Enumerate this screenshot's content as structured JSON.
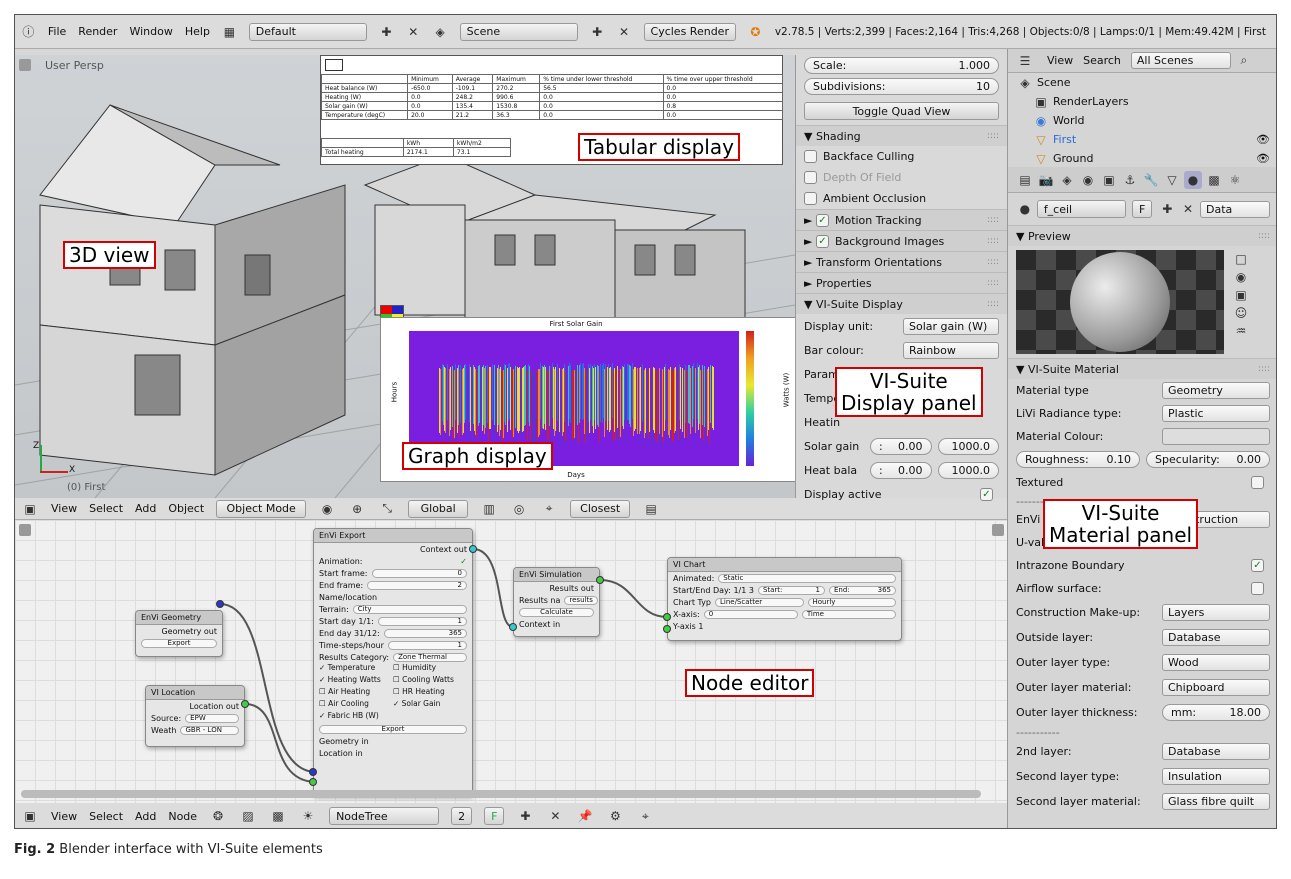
{
  "top_bar": {
    "menus": [
      "File",
      "Render",
      "Window",
      "Help"
    ],
    "layout": "Default",
    "scene": "Scene",
    "engine": "Cycles Render",
    "stats": "v2.78.5 | Verts:2,399 | Faces:2,164 | Tris:4,268 | Objects:0/8 | Lamps:0/1 | Mem:49.42M | First"
  },
  "view3d": {
    "label": "User Persp",
    "obj_label": "(0) First",
    "axis_x": "X",
    "axis_y": "Y",
    "axis_z": "Z"
  },
  "view3d_header": {
    "menus": [
      "View",
      "Select",
      "Add",
      "Object"
    ],
    "mode": "Object Mode",
    "orientation": "Global",
    "snap": "Closest"
  },
  "table": {
    "headers": [
      "",
      "Minimum",
      "Average",
      "Maximum",
      "% time under lower threshold",
      "% time over upper threshold"
    ],
    "rows": [
      [
        "Heat balance (W)",
        "-650.0",
        "-109.1",
        "270.2",
        "56.5",
        "0.0"
      ],
      [
        "Heating (W)",
        "0.0",
        "248.2",
        "990.6",
        "0.0",
        "0.0"
      ],
      [
        "Solar gain (W)",
        "0.0",
        "135.4",
        "1530.8",
        "0.0",
        "0.8"
      ],
      [
        "Temperature (degC)",
        "20.0",
        "21.2",
        "36.3",
        "0.0",
        "0.0"
      ]
    ],
    "headers2": [
      "",
      "kWh",
      "kWh/m2"
    ],
    "rows2": [
      [
        "Total heating",
        "2174.1",
        "73.1"
      ]
    ]
  },
  "graph": {
    "title": "First Solar Gain",
    "xlabel": "Days",
    "ylabel": "Hours",
    "colorbar_label": "Watts (W)",
    "xticks": [
      "0",
      "50",
      "100",
      "150",
      "200",
      "250",
      "300",
      "350"
    ],
    "yticks": [
      "0",
      "5",
      "10",
      "15",
      "20"
    ],
    "cticks": [
      "0",
      "200",
      "400",
      "600",
      "800",
      "1000"
    ]
  },
  "side3d": {
    "scale_label": "Scale:",
    "scale_value": "1.000",
    "subdivisions_label": "Subdivisions:",
    "subdivisions_value": "10",
    "toggle_quad": "Toggle Quad View",
    "shading": "Shading",
    "backface": "Backface Culling",
    "dof": "Depth Of Field",
    "ao": "Ambient Occlusion",
    "motion": "Motion Tracking",
    "bg": "Background Images",
    "transform": "Transform Orientations",
    "properties": "Properties",
    "visuite": "VI-Suite Display",
    "display_unit_label": "Display unit:",
    "display_unit": "Solar gain (W)",
    "bar_colour_label": "Bar colour:",
    "bar_colour": "Rainbow",
    "param_label": "Parameter fr",
    "temp_label": "Tempe",
    "heat_label": "Heatin",
    "solar_gain_label": "Solar gain",
    "heat_bal_label": "Heat bala",
    "min_val": "0.00",
    "max_val": "1000.0",
    "display_active": "Display active"
  },
  "outliner": {
    "menus": [
      "View",
      "Search"
    ],
    "filter": "All Scenes",
    "items": [
      "Scene",
      "RenderLayers",
      "World",
      "First",
      "Ground"
    ]
  },
  "props": {
    "material": "f_ceil",
    "user": "F",
    "data": "Data",
    "preview": "Preview",
    "visuite_material": "VI-Suite Material",
    "rows": [
      {
        "label": "Material type",
        "value": "Geometry"
      },
      {
        "label": "LiVi Radiance type:",
        "value": "Plastic"
      },
      {
        "label": "Material Colour:",
        "value": ""
      }
    ],
    "roughness_label": "Roughness:",
    "roughness": "0.10",
    "specularity_label": "Specularity:",
    "specularity": "0.00",
    "textured": "Textured",
    "envi_label": "EnVi C",
    "envi_value": "Construction",
    "uvalue": "U-value (W/m^2.K): N/A",
    "intrazone": "Intrazone Boundary",
    "airflow": "Airflow surface:",
    "rows2": [
      {
        "label": "Construction Make-up:",
        "value": "Layers"
      },
      {
        "label": "Outside layer:",
        "value": "Database"
      },
      {
        "label": "Outer layer type:",
        "value": "Wood"
      },
      {
        "label": "Outer layer material:",
        "value": "Chipboard"
      }
    ],
    "thickness_label": "Outer layer thickness:",
    "thickness_unit": "mm:",
    "thickness": "18.00",
    "dashes": "-----------",
    "rows3": [
      {
        "label": "2nd layer:",
        "value": "Database"
      },
      {
        "label": "Second layer type:",
        "value": "Insulation"
      },
      {
        "label": "Second layer material:",
        "value": "Glass fibre quilt"
      }
    ]
  },
  "node_header": {
    "menus": [
      "View",
      "Select",
      "Add",
      "Node"
    ],
    "tree": "NodeTree",
    "users": "2",
    "fake": "F"
  },
  "nodes": {
    "envi_geometry": {
      "title": "EnVi Geometry",
      "out": "Geometry out",
      "btn": "Export"
    },
    "vi_location": {
      "title": "VI Location",
      "out": "Location out",
      "source_label": "Source:",
      "source": "EPW",
      "weath_label": "Weath",
      "weath": "GBR - LON"
    },
    "envi_export": {
      "title": "EnVi Export",
      "out": "Context out",
      "animation": "Animation:",
      "start_frame": "Start frame:",
      "start_frame_v": "0",
      "end_frame": "End frame:",
      "end_frame_v": "2",
      "name": "Name/location",
      "terrain": "Terrain:",
      "terrain_v": "City",
      "start_day": "Start day 1/1:",
      "start_day_v": "1",
      "end_day": "End day 31/12:",
      "end_day_v": "365",
      "timesteps": "Time-steps/hour",
      "timesteps_v": "1",
      "results_cat": "Results Category:",
      "results_cat_v": "Zone Thermal",
      "checks": [
        [
          "Temperature",
          true
        ],
        [
          "Humidity",
          false
        ],
        [
          "Heating Watts",
          true
        ],
        [
          "Cooling Watts",
          false
        ],
        [
          "Air Heating",
          false
        ],
        [
          "HR Heating",
          false
        ],
        [
          "Air Cooling",
          false
        ],
        [
          "Solar Gain",
          true
        ],
        [
          "Fabric HB (W)",
          true
        ]
      ],
      "export": "Export",
      "geom_in": "Geometry in",
      "loc_in": "Location in"
    },
    "envi_sim": {
      "title": "EnVi Simulation",
      "out": "Results out",
      "results_name": "Results na",
      "results_v": "results",
      "calc": "Calculate",
      "ctx_in": "Context in"
    },
    "vi_chart": {
      "title": "VI Chart",
      "animated": "Animated:",
      "animated_v": "Static",
      "startend": "Start/End Day: 1/1 3",
      "start": "Start:",
      "start_v": "1",
      "end": "End:",
      "end_v": "365",
      "chart_type": "Chart Typ",
      "chart_type_v": "Line/Scatter",
      "freq": "Hourly",
      "xaxis": "X-axis:",
      "xaxis_v": "0",
      "xaxis_v2": "Time",
      "yaxis": "Y-axis 1"
    }
  },
  "labels": {
    "tabular": "Tabular display",
    "view3d": "3D view",
    "graph": "Graph display",
    "display_panel": "VI-Suite\nDisplay panel",
    "material_panel": "VI-Suite\nMaterial panel",
    "node_editor": "Node editor"
  },
  "caption": {
    "fig": "Fig. 2",
    "text": "Blender interface with VI-Suite elements"
  }
}
